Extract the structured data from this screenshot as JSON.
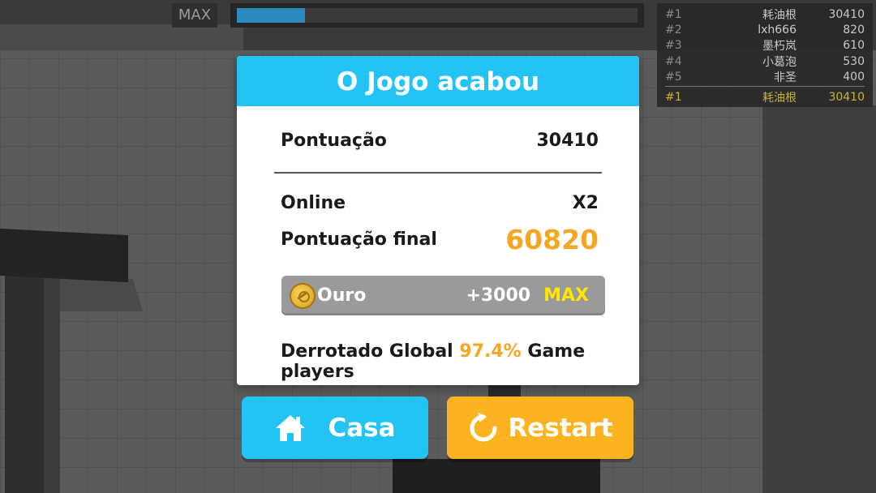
{
  "hud": {
    "max_label": "MAX",
    "progress_fraction": 0.17,
    "progress_color": "#2b8bc0"
  },
  "leaderboard": {
    "rows": [
      {
        "rank": "#1",
        "name": "耗油根",
        "score": "30410"
      },
      {
        "rank": "#2",
        "name": "lxh666",
        "score": "820"
      },
      {
        "rank": "#3",
        "name": "墨朽岚",
        "score": "610"
      },
      {
        "rank": "#4",
        "name": "小葛泡",
        "score": "530"
      },
      {
        "rank": "#5",
        "name": "非圣",
        "score": "400"
      }
    ],
    "me": {
      "rank": "#1",
      "name": "耗油根",
      "score": "30410"
    }
  },
  "dialog": {
    "title": "O Jogo acabou",
    "score_label": "Pontuação",
    "score_value": "30410",
    "online_label": "Online",
    "online_value": "X2",
    "final_label": "Pontuação final",
    "final_value": "60820",
    "gold_label": "Ouro",
    "gold_amount": "+3000",
    "gold_max": "MAX",
    "defeated_prefix": "Derrotado Global",
    "defeated_pct": "97.4%",
    "defeated_suffix": "Game players"
  },
  "buttons": {
    "home_label": "Casa",
    "restart_label": "Restart"
  },
  "icons": {
    "home": "home-icon",
    "restart": "restart-icon",
    "coin": "coin-icon"
  },
  "colors": {
    "title_bar": "#23c4f5",
    "accent_orange": "#f5a623",
    "home_button": "#23c4f5",
    "restart_button": "#fbb420",
    "gold_max": "#ffe600"
  }
}
